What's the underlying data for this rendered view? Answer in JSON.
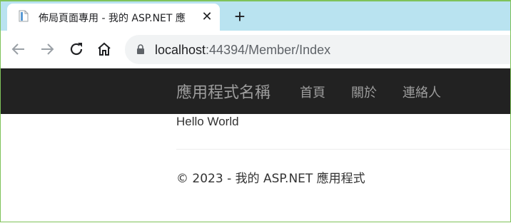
{
  "browser": {
    "tab": {
      "title": "佈局頁面專用 - 我的 ASP.NET 應",
      "close_icon": "close-icon",
      "favicon": "page-icon"
    },
    "new_tab_icon": "plus-icon",
    "nav": {
      "back_icon": "arrow-left-icon",
      "forward_icon": "arrow-right-icon",
      "reload_icon": "reload-icon",
      "home_icon": "home-icon"
    },
    "address": {
      "host": "localhost",
      "path": ":44394/Member/Index",
      "lock_icon": "lock-icon"
    },
    "colors": {
      "tabstrip": "#b9e3f0",
      "frame": "#7fc35a"
    }
  },
  "page": {
    "navbar": {
      "brand": "應用程式名稱",
      "links": [
        "首頁",
        "關於",
        "連絡人"
      ],
      "background": "#222222",
      "text_color": "#9d9d9d"
    },
    "content": {
      "text": "Hello World"
    },
    "footer": {
      "text": "© 2023 - 我的 ASP.NET 應用程式"
    }
  }
}
